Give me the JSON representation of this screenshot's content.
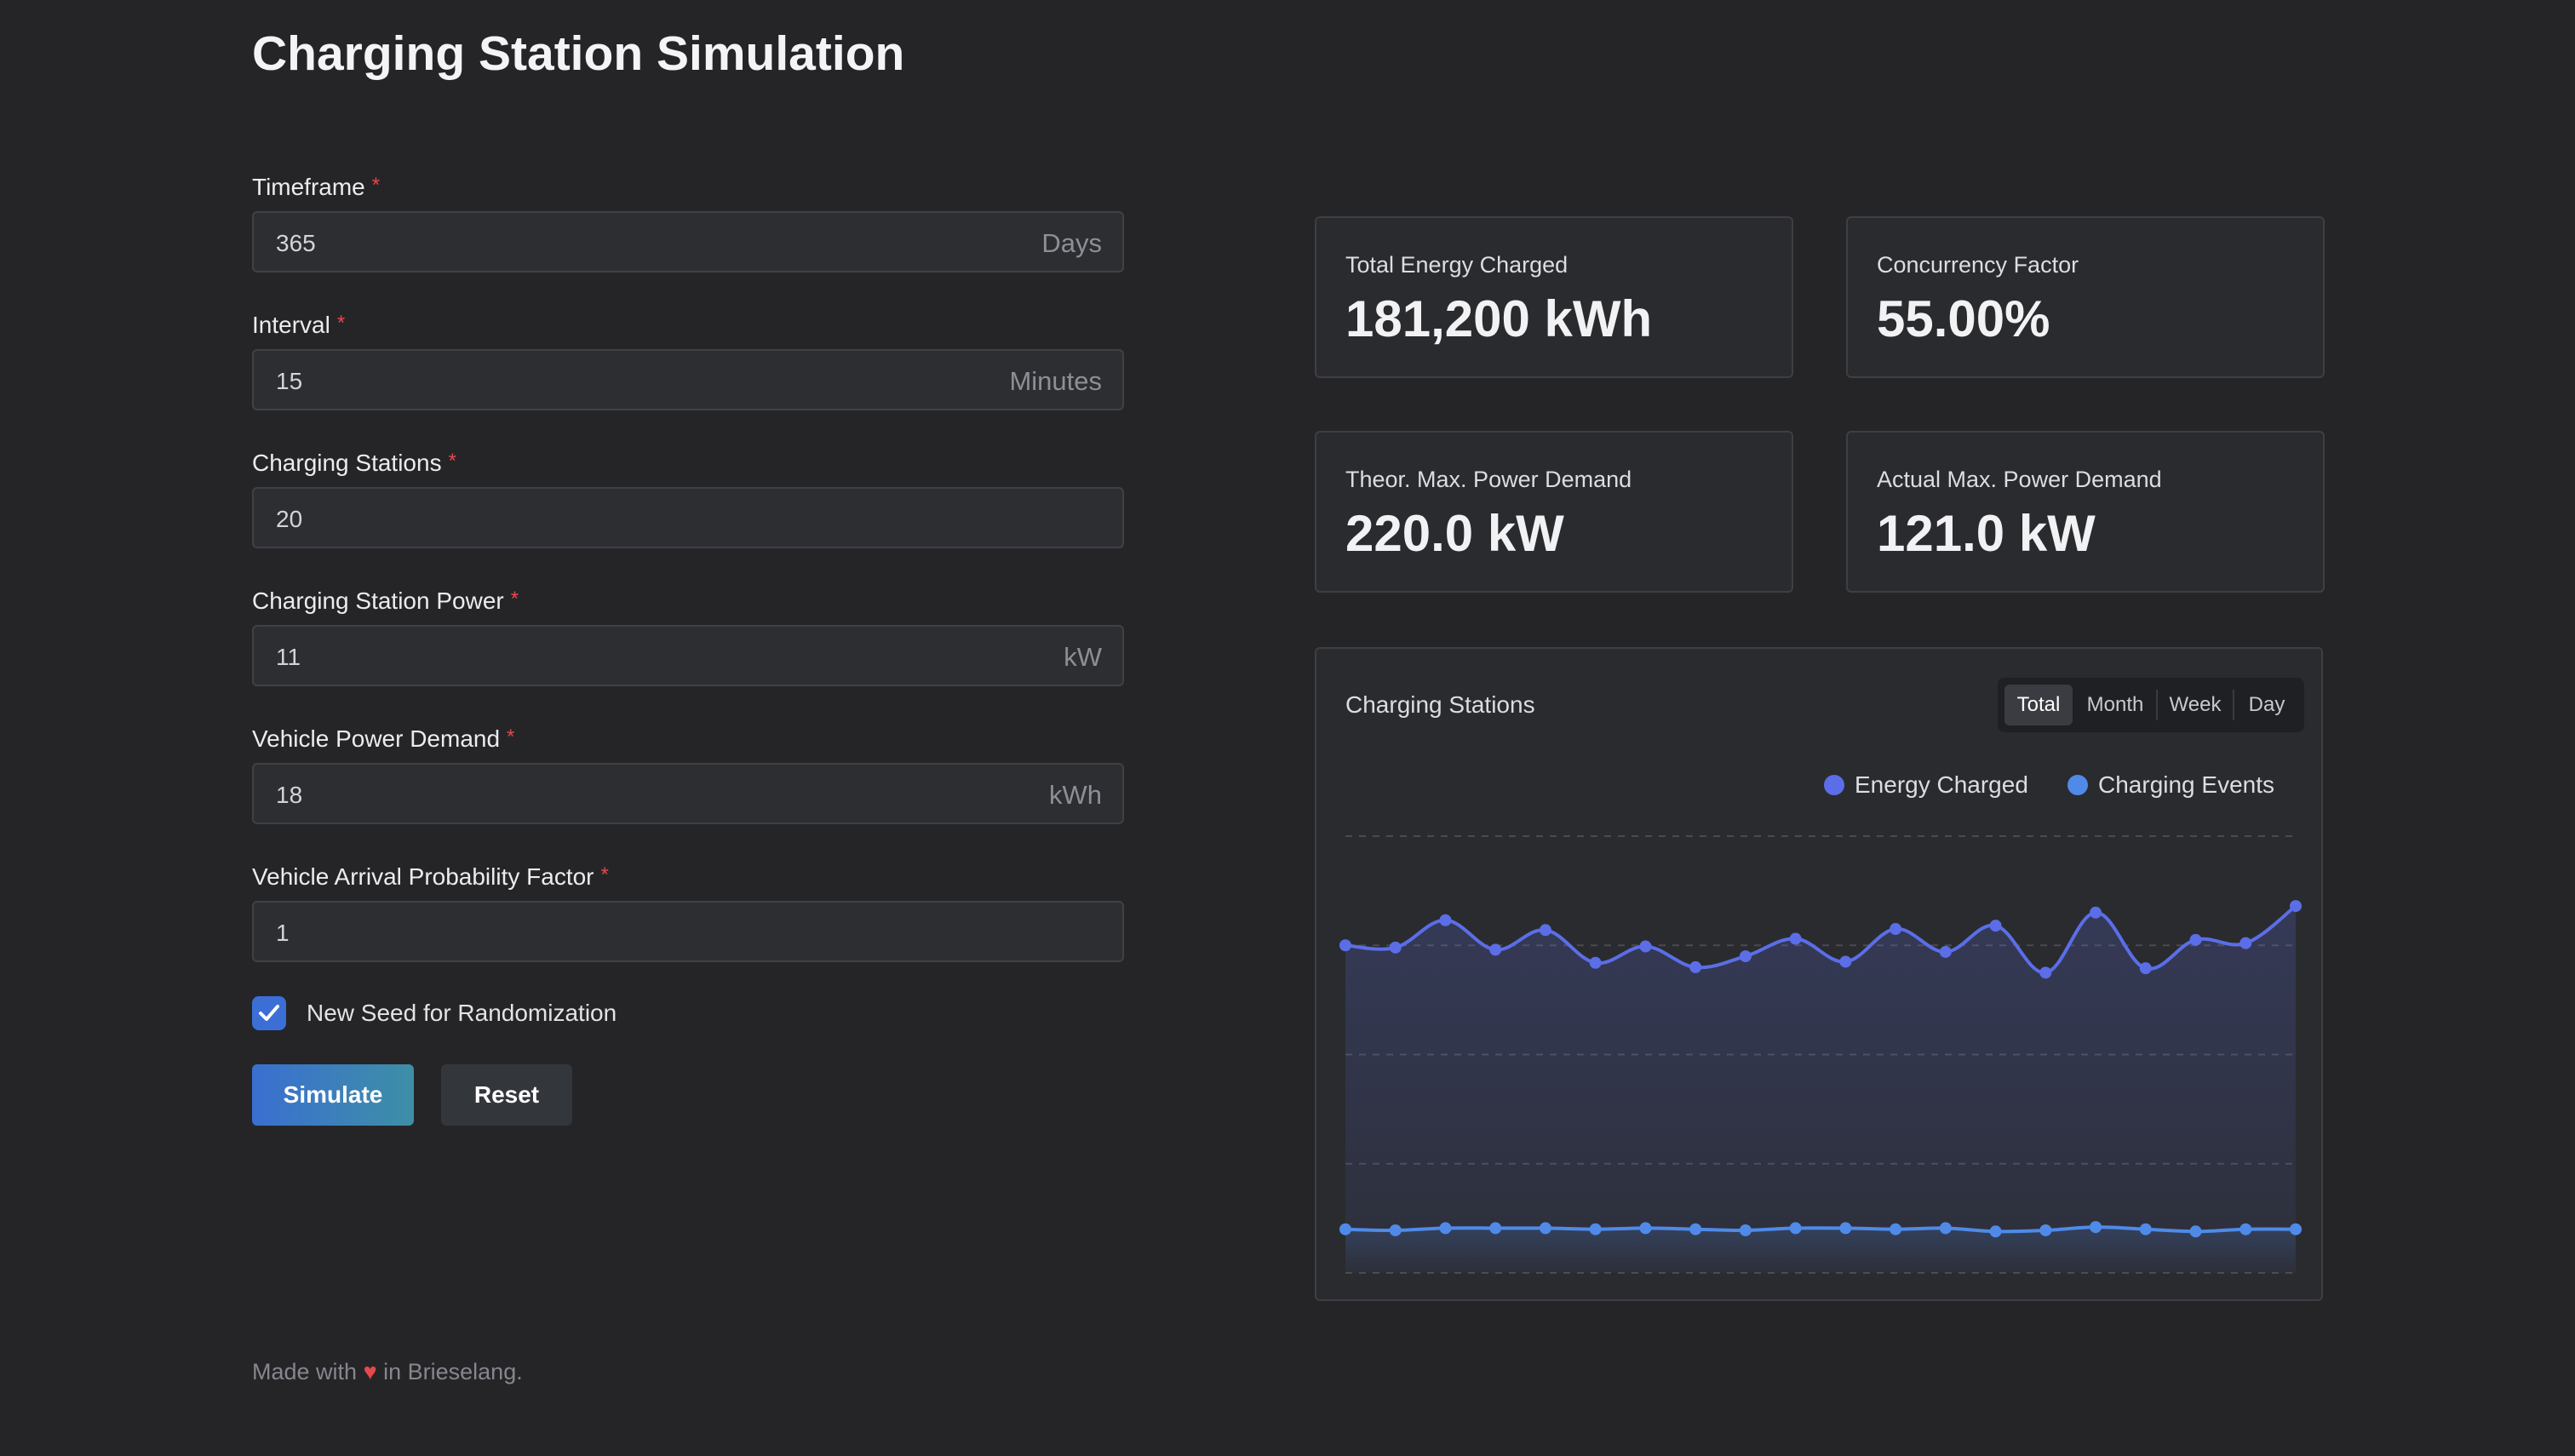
{
  "page": {
    "title": "Charging Station Simulation",
    "footer": {
      "prefix": "Made with",
      "heart": "♥",
      "suffix": "in Brieselang."
    }
  },
  "form": {
    "fields": [
      {
        "label": "Timeframe",
        "required": "*",
        "value": "365",
        "unit": "Days"
      },
      {
        "label": "Interval",
        "required": "*",
        "value": "15",
        "unit": "Minutes"
      },
      {
        "label": "Charging Stations",
        "required": "*",
        "value": "20",
        "unit": ""
      },
      {
        "label": "Charging Station Power",
        "required": "*",
        "value": "11",
        "unit": "kW"
      },
      {
        "label": "Vehicle Power Demand",
        "required": "*",
        "value": "18",
        "unit": "kWh"
      },
      {
        "label": "Vehicle Arrival Probability Factor",
        "required": "*",
        "value": "1",
        "unit": ""
      }
    ],
    "seed_checkbox": {
      "label": "New Seed for Randomization",
      "checked": true
    },
    "simulate_label": "Simulate",
    "reset_label": "Reset"
  },
  "stats": [
    {
      "label": "Total Energy Charged",
      "value": "181,200 kWh"
    },
    {
      "label": "Concurrency Factor",
      "value": "55.00%"
    },
    {
      "label": "Theor. Max. Power Demand",
      "value": "220.0 kW"
    },
    {
      "label": "Actual Max. Power Demand",
      "value": "121.0 kW"
    }
  ],
  "chart_card": {
    "title": "Charging Stations",
    "tabs": [
      "Total",
      "Month",
      "Week",
      "Day"
    ],
    "active_tab": "Total",
    "colors": {
      "energy": "#5b6ee8",
      "events": "#4f8ae8",
      "grid": "#4a4b50"
    }
  },
  "chart_data": {
    "type": "area",
    "title": "",
    "xlabel": "",
    "ylabel": "",
    "grid": true,
    "legend": "top-right",
    "x": [
      1,
      2,
      3,
      4,
      5,
      6,
      7,
      8,
      9,
      10,
      11,
      12,
      13,
      14,
      15,
      16,
      17,
      18,
      19,
      20
    ],
    "ylim": [
      0,
      4
    ],
    "series": [
      {
        "name": "Energy Charged",
        "values": [
          3.0,
          2.98,
          3.23,
          2.96,
          3.14,
          2.84,
          2.99,
          2.8,
          2.9,
          3.06,
          2.85,
          3.15,
          2.94,
          3.18,
          2.75,
          3.3,
          2.79,
          3.05,
          3.02,
          3.36
        ]
      },
      {
        "name": "Charging Events",
        "values": [
          0.4,
          0.39,
          0.41,
          0.41,
          0.41,
          0.4,
          0.41,
          0.4,
          0.39,
          0.41,
          0.41,
          0.4,
          0.41,
          0.38,
          0.39,
          0.42,
          0.4,
          0.38,
          0.4,
          0.4
        ]
      }
    ]
  }
}
